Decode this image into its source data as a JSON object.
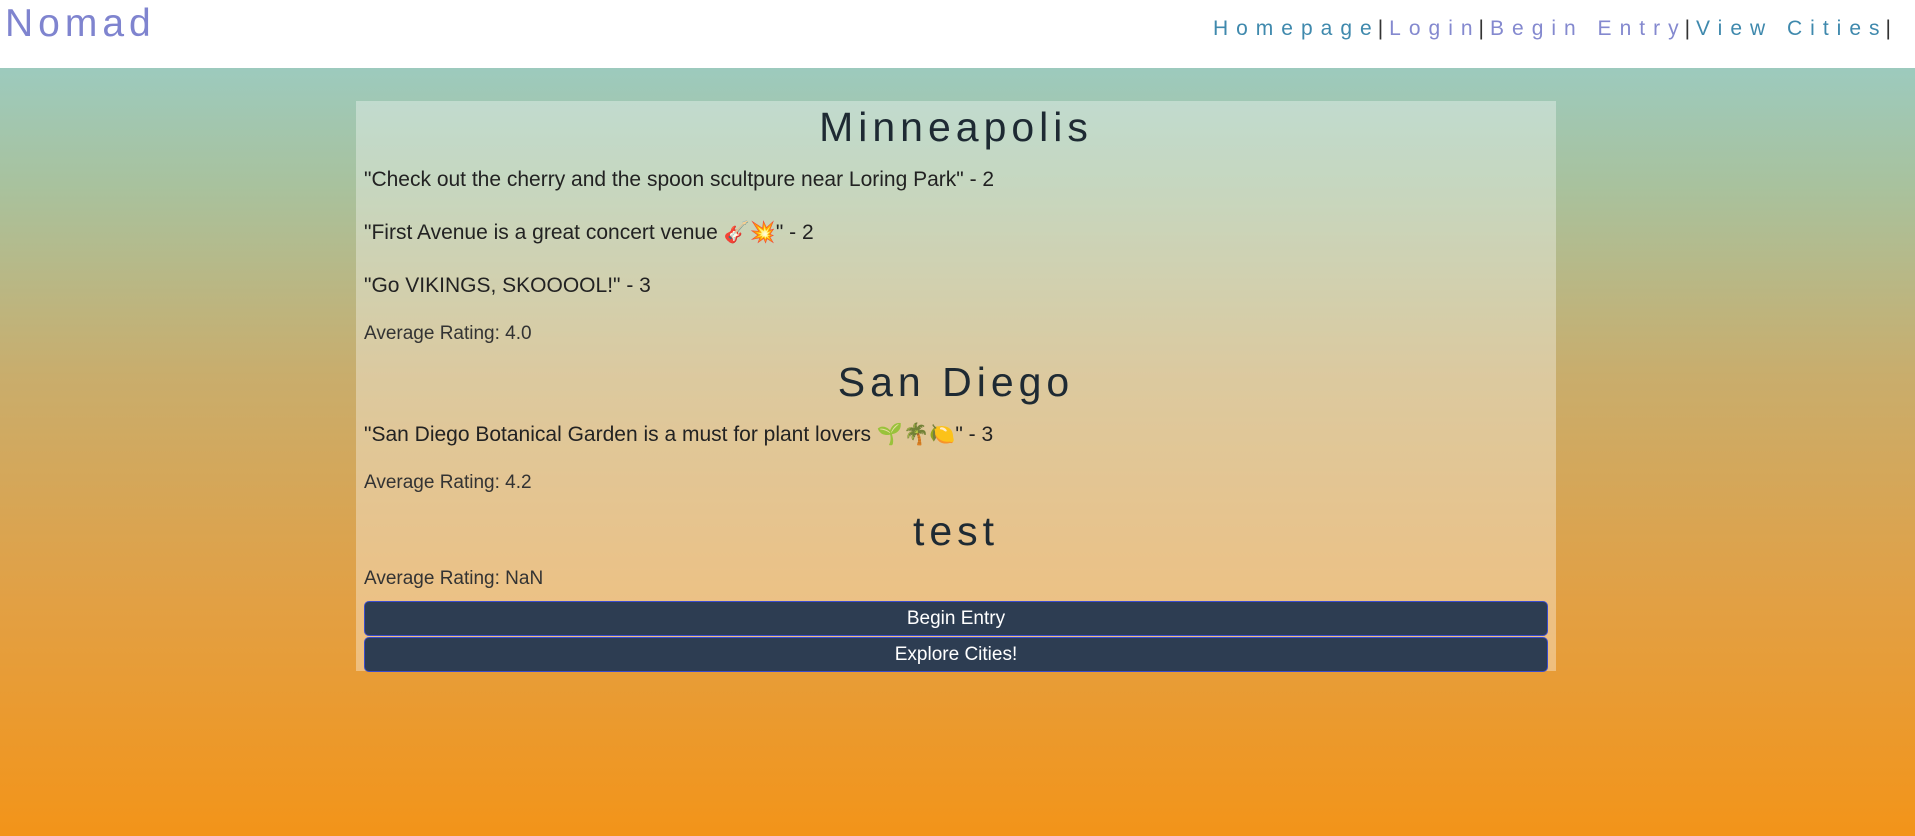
{
  "header": {
    "brand": "Nomad",
    "nav": [
      {
        "label": "Homepage"
      },
      {
        "label": "Login"
      },
      {
        "label": "Begin Entry"
      },
      {
        "label": "View Cities"
      }
    ],
    "separator": "|"
  },
  "cities": [
    {
      "name": "Minneapolis",
      "comments": [
        {
          "text": "\"Check out the cherry and the spoon scultpure near Loring Park\" - 2"
        },
        {
          "text": "\"First Avenue is a great concert venue 🎸💥\" - 2"
        },
        {
          "text": "\"Go VIKINGS, SKOOOOL!\" - 3"
        }
      ],
      "average": "Average Rating: 4.0"
    },
    {
      "name": "San Diego",
      "comments": [
        {
          "text": "\"San Diego Botanical Garden is a must for plant lovers 🌱🌴🍋\" - 3"
        }
      ],
      "average": "Average Rating: 4.2"
    },
    {
      "name": "test",
      "comments": [],
      "average": "Average Rating: NaN"
    }
  ],
  "buttons": {
    "begin_entry": "Begin Entry",
    "explore_cities": "Explore Cities!"
  },
  "colors": {
    "brand": "#7f84cf",
    "nav_link": "#3f89ad",
    "button_bg": "#2d3d52"
  }
}
